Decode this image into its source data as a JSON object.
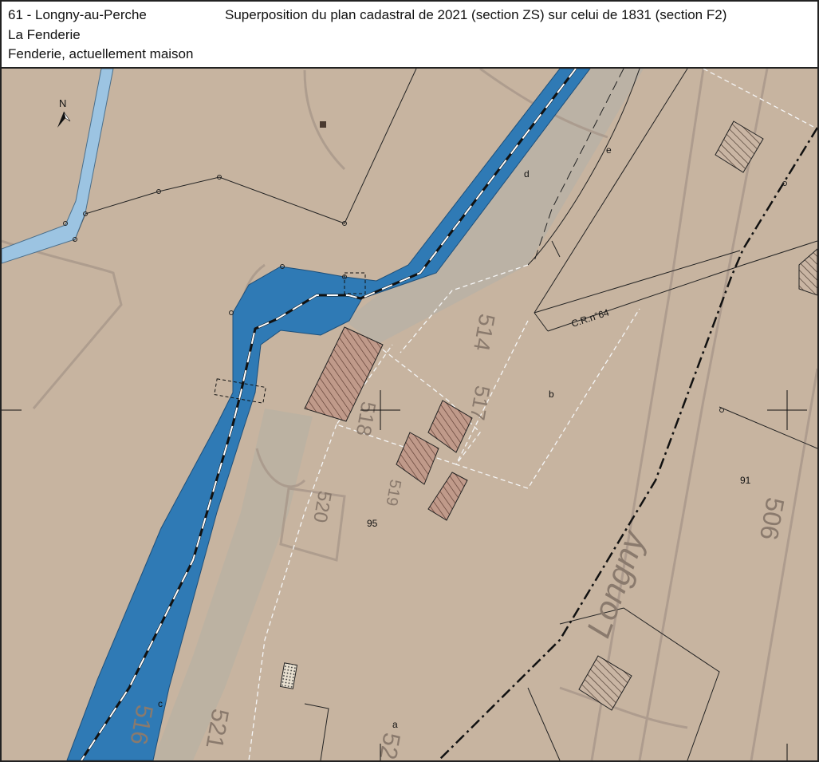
{
  "header": {
    "line1": "61 - Longny-au-Perche",
    "line2": "La Fenderie",
    "line3": "Fenderie, actuellement maison",
    "title": "Superposition du plan cadastral de 2021 (section ZS) sur celui de 1831 (section F2)"
  },
  "map": {
    "north_label": "N",
    "parcel_labels": {
      "d": "d",
      "e": "e",
      "b": "b",
      "c": "c",
      "a": "a",
      "p95": "95",
      "p91": "91"
    },
    "road_label": "C.R.n°64",
    "old_labels": {
      "n514": "514",
      "n516": "516",
      "n517": "517",
      "n518": "518",
      "n520": "520",
      "n521": "521",
      "n519": "519",
      "n525": "52",
      "n506": "506",
      "longny": "Longny"
    },
    "colors": {
      "background": "#c7b4a0",
      "river": "#2f7ab5",
      "canal": "#9cc4e2",
      "building_hatch": "#6b4a3a",
      "old_parcel_line": "#a8978a"
    }
  }
}
